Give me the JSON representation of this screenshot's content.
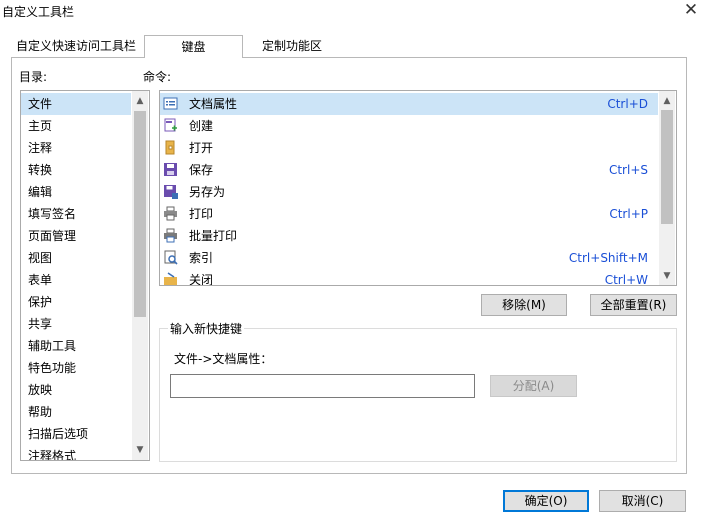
{
  "dialog": {
    "title": "自定义工具栏",
    "tabs": [
      {
        "label": "自定义快速访问工具栏"
      },
      {
        "label": "键盘"
      },
      {
        "label": "定制功能区"
      }
    ],
    "catalog_label": "目录:",
    "command_label": "命令:",
    "categories": [
      "文件",
      "主页",
      "注释",
      "转换",
      "编辑",
      "填写签名",
      "页面管理",
      "视图",
      "表单",
      "保护",
      "共享",
      "辅助工具",
      "特色功能",
      "放映",
      "帮助",
      "扫描后选项",
      "注释格式"
    ],
    "commands": [
      {
        "name": "文档属性",
        "shortcut": "Ctrl+D",
        "icon": "document-properties-icon"
      },
      {
        "name": "创建",
        "shortcut": "",
        "icon": "create-pdf-icon"
      },
      {
        "name": "打开",
        "shortcut": "",
        "icon": "open-folder-icon"
      },
      {
        "name": "保存",
        "shortcut": "Ctrl+S",
        "icon": "save-icon"
      },
      {
        "name": "另存为",
        "shortcut": "",
        "icon": "save-as-icon"
      },
      {
        "name": "打印",
        "shortcut": "Ctrl+P",
        "icon": "print-icon"
      },
      {
        "name": "批量打印",
        "shortcut": "",
        "icon": "batch-print-icon"
      },
      {
        "name": "索引",
        "shortcut": "Ctrl+Shift+M",
        "icon": "index-icon"
      },
      {
        "name": "关闭",
        "shortcut": "Ctrl+W",
        "icon": "close-file-icon"
      }
    ],
    "remove_label": "移除(M)",
    "reset_all_label": "全部重置(R)",
    "new_shortcut_group": "输入新快捷键",
    "target_path": "文件->文档属性：",
    "shortcut_input_value": "",
    "assign_label": "分配(A)",
    "ok_label": "确定(O)",
    "cancel_label": "取消(C)",
    "colors": {
      "selection": "#cce4f7",
      "shortcut_text": "#1a4fd6",
      "default_button_border": "#0078d7"
    }
  }
}
